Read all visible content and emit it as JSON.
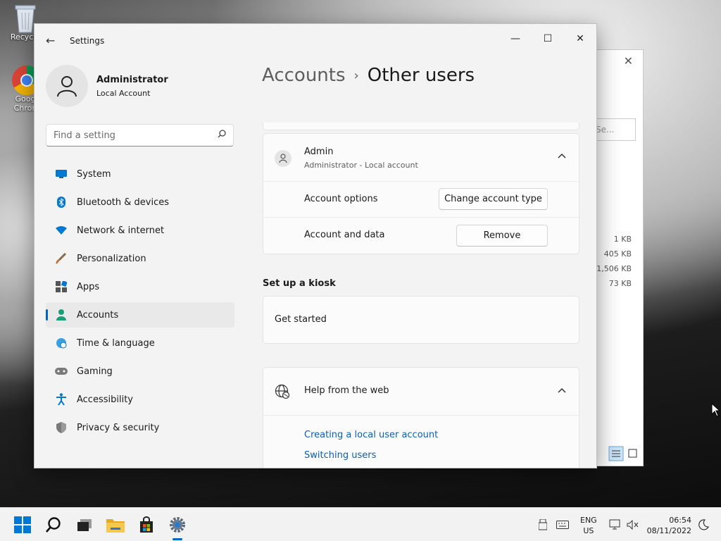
{
  "desktop": {
    "icons": [
      {
        "label": "Recycle",
        "icon": "recycle-bin-icon"
      },
      {
        "label": "Goog Chron",
        "icon": "chrome-icon"
      }
    ]
  },
  "background_window": {
    "search_placeholder": "Se...",
    "sizes": [
      "1 KB",
      "405 KB",
      "1,506 KB",
      "73 KB"
    ]
  },
  "settings": {
    "window_title": "Settings",
    "profile": {
      "name": "Administrator",
      "account_type": "Local Account"
    },
    "search": {
      "placeholder": "Find a setting"
    },
    "nav": [
      {
        "label": "System",
        "icon": "monitor-icon",
        "color": "#0078d4"
      },
      {
        "label": "Bluetooth & devices",
        "icon": "bluetooth-icon",
        "color": "#0078d4"
      },
      {
        "label": "Network & internet",
        "icon": "wifi-icon",
        "color": "#0078d4"
      },
      {
        "label": "Personalization",
        "icon": "brush-icon",
        "color": "#c46a2b"
      },
      {
        "label": "Apps",
        "icon": "apps-icon",
        "color": "#555555"
      },
      {
        "label": "Accounts",
        "icon": "person-icon",
        "color": "#1a9e78",
        "active": true
      },
      {
        "label": "Time & language",
        "icon": "globe-clock-icon",
        "color": "#0078d4"
      },
      {
        "label": "Gaming",
        "icon": "gamepad-icon",
        "color": "#6b6b6b"
      },
      {
        "label": "Accessibility",
        "icon": "accessibility-icon",
        "color": "#0078d4"
      },
      {
        "label": "Privacy & security",
        "icon": "shield-icon",
        "color": "#6b6b6b"
      }
    ],
    "breadcrumb": {
      "parent": "Accounts",
      "separator": "›",
      "current": "Other users"
    },
    "admin_user": {
      "name": "Admin",
      "detail": "Administrator - Local account",
      "options_label": "Account options",
      "change_button": "Change account type",
      "data_label": "Account and data",
      "remove_button": "Remove"
    },
    "kiosk": {
      "heading": "Set up a kiosk",
      "get_started": "Get started"
    },
    "help": {
      "title": "Help from the web",
      "links": [
        "Creating a local user account",
        "Switching users"
      ]
    }
  },
  "taskbar": {
    "language": {
      "line1": "ENG",
      "line2": "US"
    },
    "time": "06:54",
    "date": "08/11/2022",
    "accent": "#0067c0"
  }
}
